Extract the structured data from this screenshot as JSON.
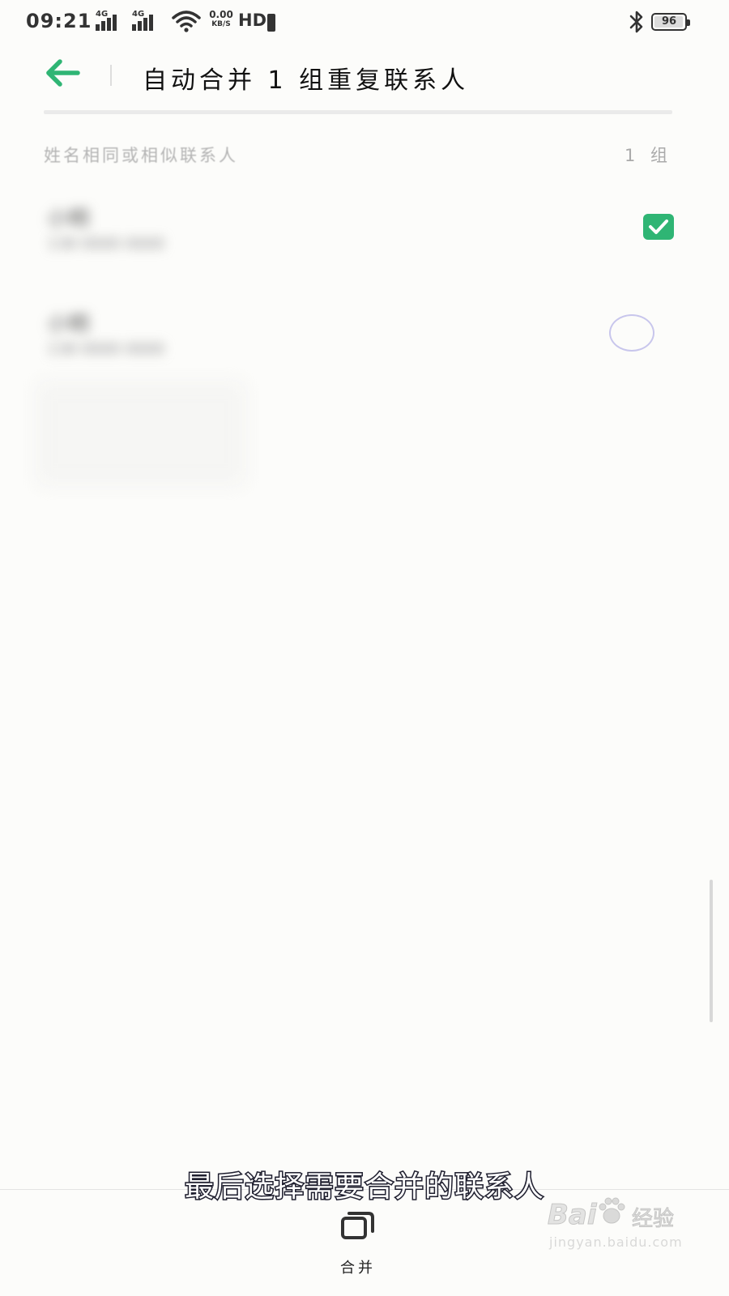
{
  "status_bar": {
    "time": "09:21",
    "network_1": "4G",
    "network_2": "4G",
    "speed_value": "0.00",
    "speed_unit": "KB/S",
    "hd_label": "HD",
    "battery": "96",
    "battery_level": 0.96,
    "icons": [
      "signal-icon",
      "wifi-icon",
      "sim-icon",
      "bluetooth-icon",
      "battery-icon"
    ]
  },
  "header": {
    "title": "自动合并 1 组重复联系人",
    "back_icon": "arrow-left-icon"
  },
  "section": {
    "label": "姓名相同或相似联系人",
    "count": "1 组"
  },
  "contacts": [
    {
      "name": "小明",
      "phone": "138 0000 0000",
      "selected": true
    },
    {
      "name": "小明",
      "phone": "138 0000 0000",
      "selected": false
    }
  ],
  "bottom_bar": {
    "merge_label": "合并",
    "merge_icon": "merge-icon"
  },
  "caption": "最后选择需要合并的联系人",
  "watermark": {
    "logo": "Bai",
    "logo_suffix": "经验",
    "url": "jingyan.baidu.com"
  },
  "colors": {
    "accent": "#2fb574",
    "background": "#fcfcfa",
    "radio_border": "#c8c6ec"
  }
}
